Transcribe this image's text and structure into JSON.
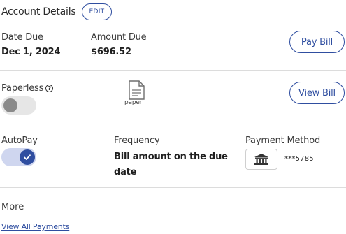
{
  "header": {
    "title": "Account Details",
    "edit_label": "EDIT"
  },
  "bill": {
    "date_due_label": "Date Due",
    "date_due_value": "Dec 1, 2024",
    "amount_due_label": "Amount Due",
    "amount_due_value": "$696.52",
    "pay_bill_label": "Pay Bill"
  },
  "paperless": {
    "label": "Paperless",
    "help_glyph": "?",
    "enabled": false,
    "paper_caption": "paper",
    "view_bill_label": "View Bill"
  },
  "autopay": {
    "label": "AutoPay",
    "enabled": true,
    "frequency_label": "Frequency",
    "frequency_value": "Bill amount on the due date",
    "payment_method_label": "Payment Method",
    "payment_method_icon": "bank-icon",
    "account_mask": "***5785"
  },
  "more": {
    "label": "More",
    "view_all_payments_label": "View All Payments"
  },
  "colors": {
    "accent": "#2f4ea0",
    "divider": "#dcdcdc",
    "toggle_off": "#e6e6e6"
  }
}
